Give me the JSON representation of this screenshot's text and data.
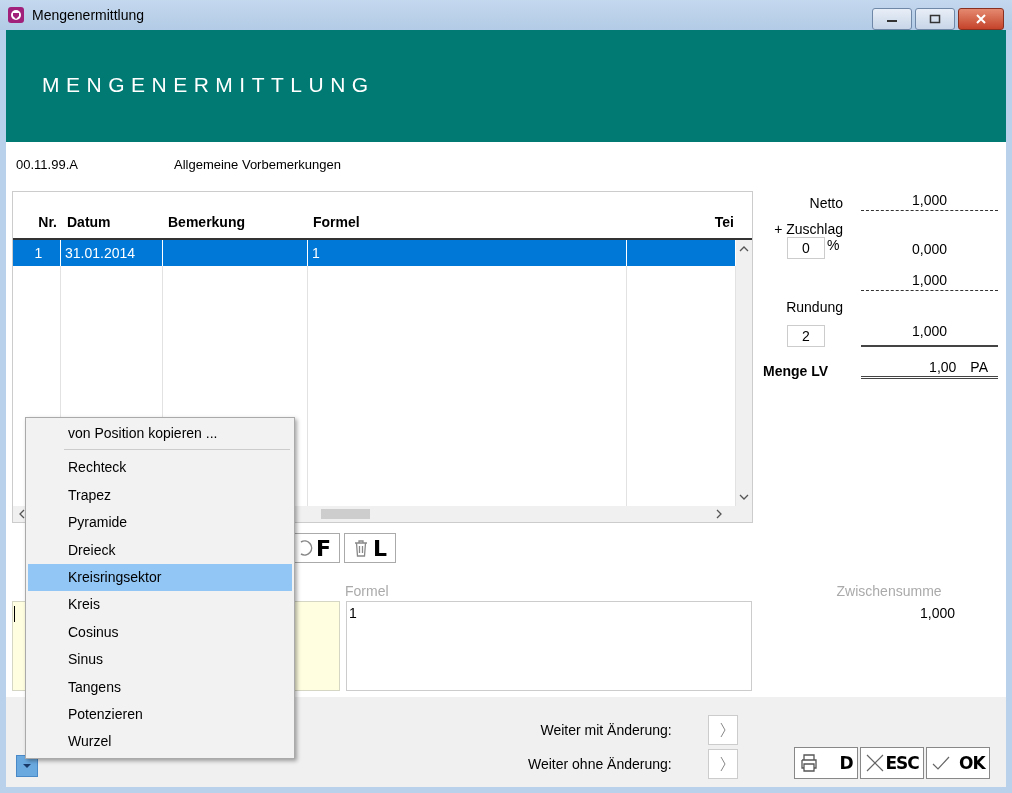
{
  "window": {
    "title": "Mengenermittlung"
  },
  "header": {
    "title": "MENGENERMITTLUNG"
  },
  "position": {
    "number": "00.11.99.A",
    "text": "Allgemeine Vorbemerkungen"
  },
  "table": {
    "columns": [
      "Nr.",
      "Datum",
      "Bemerkung",
      "Formel",
      "Tei"
    ],
    "rows": [
      {
        "nr": "1",
        "datum": "31.01.2014",
        "formel": "1",
        "selected": true
      }
    ]
  },
  "totals": {
    "netto_label": "Netto",
    "netto": "1,000",
    "zuschlag_label": "+ Zuschlag",
    "zuschlag_percent": "0",
    "percent_sign": "%",
    "zuschlag": "0,000",
    "subtotal": "1,000",
    "rundung_label": "Rundung",
    "rundung_digits": "2",
    "rounded": "1,000",
    "menge_label": "Menge LV",
    "menge": "1,00",
    "unit": "PA"
  },
  "toolbar": [
    {
      "label": "F",
      "kind": "formula"
    },
    {
      "label": "L",
      "kind": "delete"
    }
  ],
  "editor": {
    "formula_label": "Formel",
    "formula": "1",
    "zwischensumme_label": "Zwischensumme",
    "zwischensumme": "1,000"
  },
  "footer": {
    "next_changed": "Weiter mit Änderung:",
    "next_unchanged": "Weiter ohne Änderung:",
    "buttons": [
      {
        "label": "D",
        "kind": "print"
      },
      {
        "label": "ESC",
        "kind": "cancel"
      },
      {
        "label": "OK",
        "kind": "ok"
      }
    ]
  },
  "context_menu": {
    "copy_item": {
      "label": "von Position kopieren ...",
      "selected": false
    },
    "items": [
      {
        "label": "Rechteck",
        "selected": false
      },
      {
        "label": "Trapez",
        "selected": false
      },
      {
        "label": "Pyramide",
        "selected": false
      },
      {
        "label": "Dreieck",
        "selected": false
      },
      {
        "label": "Kreisringsektor",
        "selected": true
      },
      {
        "label": "Kreis",
        "selected": false
      },
      {
        "label": "Cosinus",
        "selected": false
      },
      {
        "label": "Sinus",
        "selected": false
      },
      {
        "label": "Tangens",
        "selected": false
      },
      {
        "label": "Potenzieren",
        "selected": false
      },
      {
        "label": "Wurzel",
        "selected": false
      }
    ]
  }
}
